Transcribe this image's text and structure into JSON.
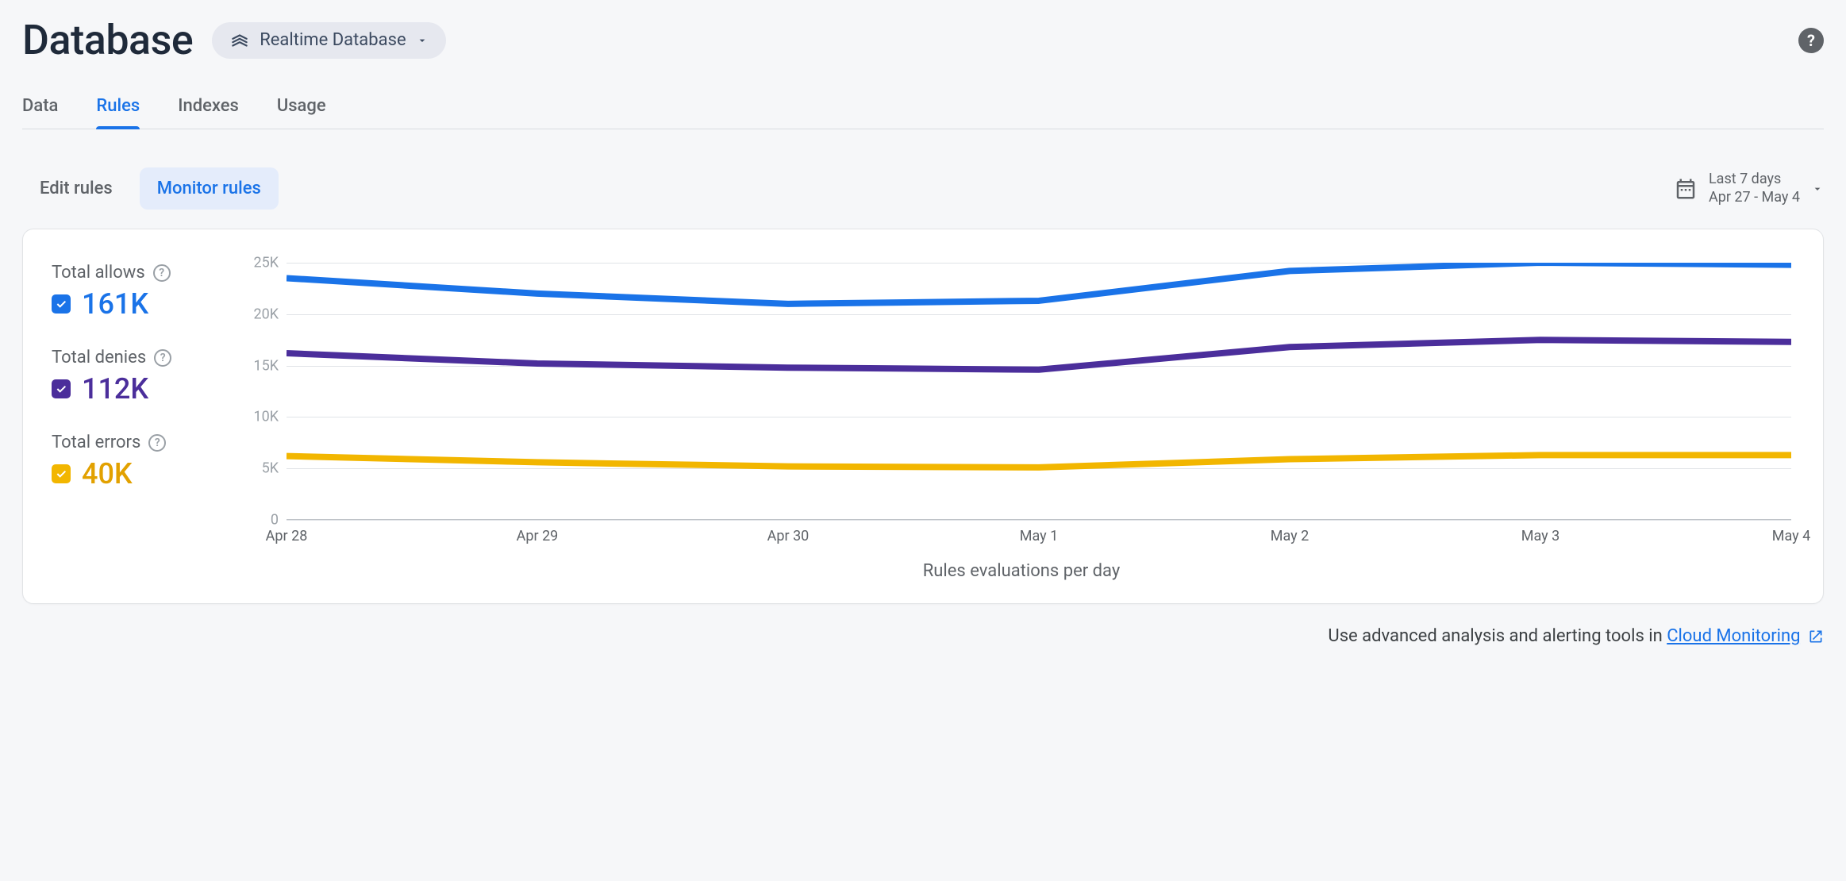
{
  "header": {
    "title": "Database",
    "db_selector_label": "Realtime Database"
  },
  "tabs": [
    {
      "id": "data",
      "label": "Data",
      "active": false
    },
    {
      "id": "rules",
      "label": "Rules",
      "active": true
    },
    {
      "id": "indexes",
      "label": "Indexes",
      "active": false
    },
    {
      "id": "usage",
      "label": "Usage",
      "active": false
    }
  ],
  "subtabs": [
    {
      "id": "edit",
      "label": "Edit rules",
      "active": false
    },
    {
      "id": "monitor",
      "label": "Monitor rules",
      "active": true
    }
  ],
  "daterange": {
    "label": "Last 7 days",
    "range": "Apr 27 - May 4"
  },
  "legend": {
    "allows": {
      "label": "Total allows",
      "value": "161K",
      "color": "blue"
    },
    "denies": {
      "label": "Total denies",
      "value": "112K",
      "color": "purple"
    },
    "errors": {
      "label": "Total errors",
      "value": "40K",
      "color": "gold"
    }
  },
  "chart_data": {
    "type": "line",
    "xlabel": "Rules evaluations per day",
    "ylabel": "",
    "ylim": [
      0,
      25000
    ],
    "y_ticks": [
      0,
      5000,
      10000,
      15000,
      20000,
      25000
    ],
    "y_tick_labels": [
      "0",
      "5K",
      "10K",
      "15K",
      "20K",
      "25K"
    ],
    "categories": [
      "Apr 28",
      "Apr 29",
      "Apr 30",
      "May 1",
      "May 2",
      "May 3",
      "May 4"
    ],
    "series": [
      {
        "name": "Total allows",
        "color": "#1a73e8",
        "values": [
          23500,
          22000,
          21000,
          21300,
          24200,
          25000,
          24800
        ]
      },
      {
        "name": "Total denies",
        "color": "#4b2e9b",
        "values": [
          16200,
          15200,
          14800,
          14600,
          16800,
          17500,
          17300
        ]
      },
      {
        "name": "Total errors",
        "color": "#f2b600",
        "values": [
          6200,
          5600,
          5200,
          5100,
          5900,
          6300,
          6300
        ]
      }
    ]
  },
  "footer": {
    "prefix": "Use advanced analysis and alerting tools in ",
    "link": "Cloud Monitoring"
  }
}
